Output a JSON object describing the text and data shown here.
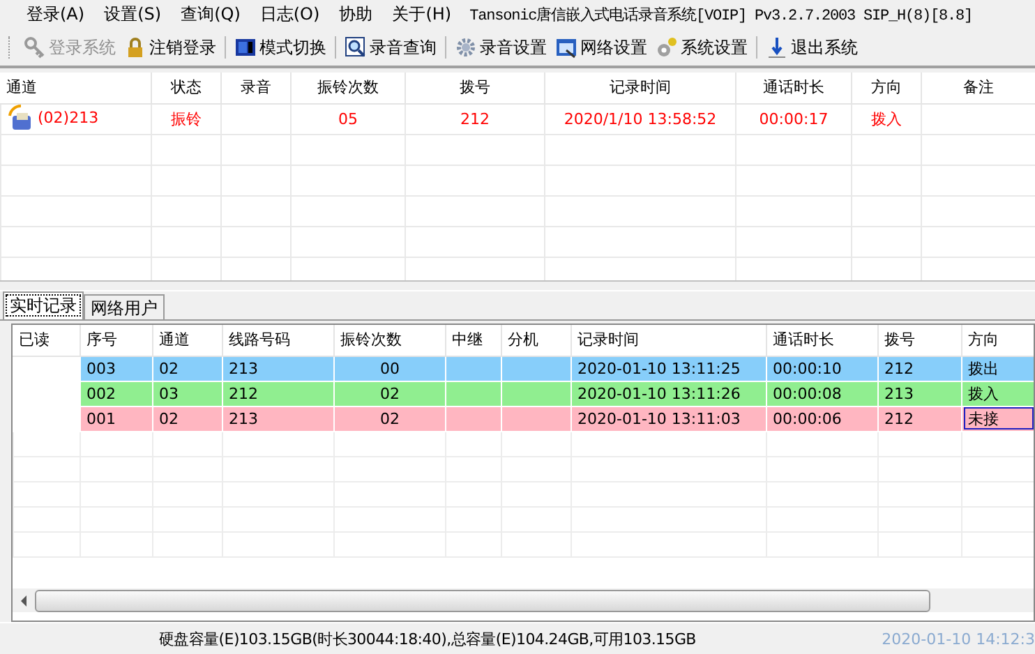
{
  "window": {
    "title": "Tansonic唐信嵌入式电话录音系统[VOIP] Pv3.2.7.2003 SIP_H(8)[8.8]"
  },
  "menu": [
    "登录(A)",
    "设置(S)",
    "查询(Q)",
    "日志(O)",
    "协助",
    "关于(H)"
  ],
  "toolbar": [
    {
      "label": "登录系统",
      "disabled": true
    },
    {
      "label": "注销登录",
      "disabled": false
    },
    {
      "label": "模式切换",
      "disabled": false
    },
    {
      "label": "录音查询",
      "disabled": false
    },
    {
      "label": "录音设置",
      "disabled": false
    },
    {
      "label": "网络设置",
      "disabled": false
    },
    {
      "label": "系统设置",
      "disabled": false
    },
    {
      "label": "退出系统",
      "disabled": false
    }
  ],
  "channel_table": {
    "columns": [
      "通道",
      "状态",
      "录音",
      "振铃次数",
      "拨号",
      "记录时间",
      "通话时长",
      "方向",
      "备注"
    ],
    "rows": [
      {
        "cells": [
          "(02)213",
          "振铃",
          "",
          "05",
          "212",
          "2020/1/10 13:58:52",
          "00:00:17",
          "拨入",
          ""
        ]
      }
    ]
  },
  "tabs": [
    {
      "label": "实时记录",
      "selected": true
    },
    {
      "label": "网络用户",
      "selected": false
    }
  ],
  "record_table": {
    "columns": [
      "已读",
      "序号",
      "通道",
      "线路号码",
      "振铃次数",
      "中继",
      "分机",
      "记录时间",
      "通话时长",
      "拨号",
      "方向"
    ],
    "rows": [
      {
        "color": "#87cefa",
        "focused": false,
        "cells": [
          "",
          "003",
          "02",
          "213",
          "00",
          "",
          "",
          "2020-01-10 13:11:25",
          "00:00:10",
          "212",
          "拨出"
        ]
      },
      {
        "color": "#90ee90",
        "focused": false,
        "cells": [
          "",
          "002",
          "03",
          "212",
          "02",
          "",
          "",
          "2020-01-10 13:11:26",
          "00:00:08",
          "213",
          "拨入"
        ]
      },
      {
        "color": "#ffb6c1",
        "focused": true,
        "cells": [
          "",
          "001",
          "02",
          "213",
          "02",
          "",
          "",
          "2020-01-10 13:11:03",
          "00:00:06",
          "212",
          "未接"
        ]
      }
    ]
  },
  "status_bar": {
    "disk": "硬盘容量(E)103.15GB(时长30044:18:40),总容量(E)104.24GB,可用103.15GB",
    "time": "2020-01-10 14:12:3"
  }
}
